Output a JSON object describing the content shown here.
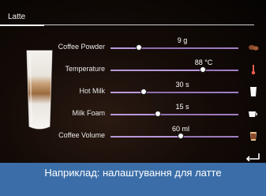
{
  "header": {
    "title": "Latte"
  },
  "settings": [
    {
      "label": "Coffee Powder",
      "value": "9 g",
      "level": 0.22,
      "icon": "coffee-beans-icon"
    },
    {
      "label": "Temperature",
      "value": "88 °C",
      "level": 0.72,
      "icon": "thermometer-icon"
    },
    {
      "label": "Hot Milk",
      "value": "30 s",
      "level": 0.26,
      "icon": "milk-glass-icon"
    },
    {
      "label": "Milk Foam",
      "value": "15 s",
      "level": 0.37,
      "icon": "milk-foam-cup-icon"
    },
    {
      "label": "Coffee Volume",
      "value": "60 ml",
      "level": 0.55,
      "icon": "coffee-cup-icon"
    }
  ],
  "caption": "Наприклад: налаштування для латте",
  "colors": {
    "accent": "#b38bd6",
    "caption_bg": "#3b6ea8"
  }
}
